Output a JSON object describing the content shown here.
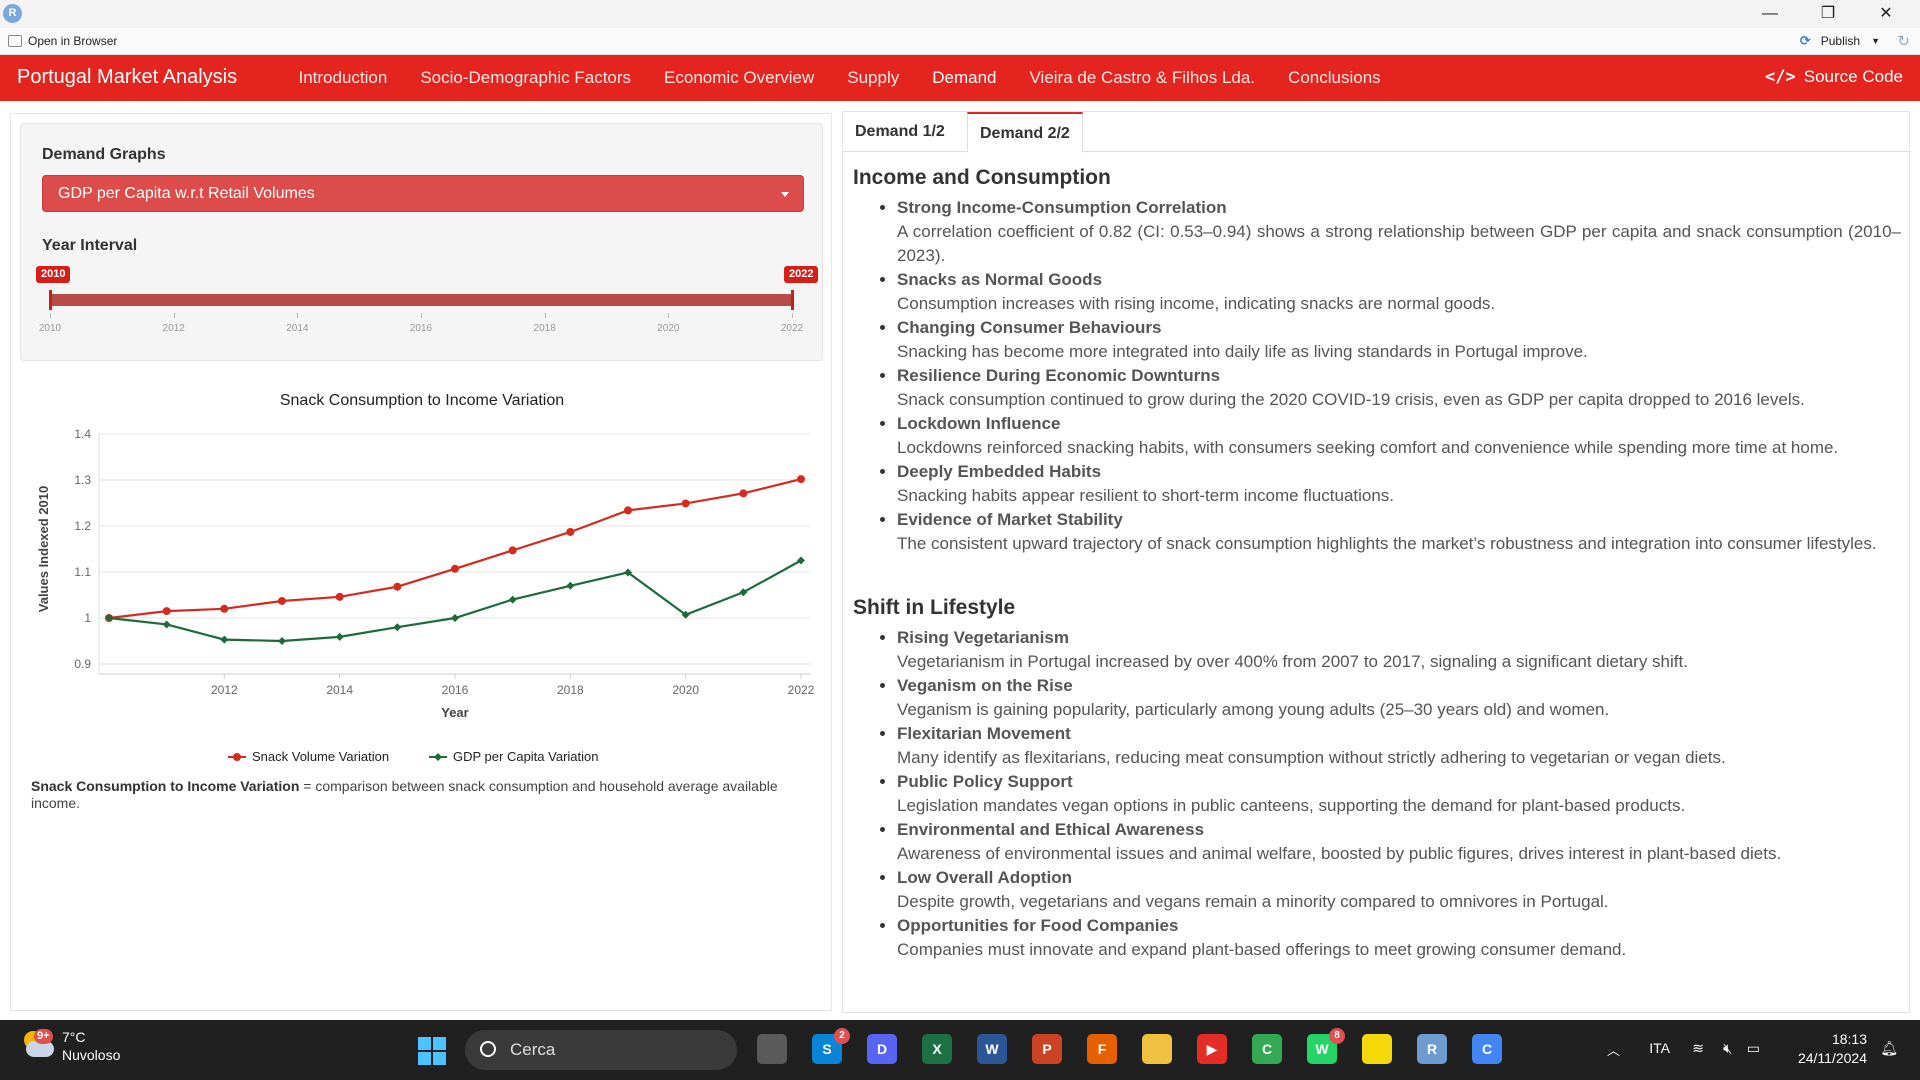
{
  "window": {
    "app_icon_letter": "R",
    "open_in_browser": "Open in Browser",
    "publish": "Publish",
    "minimize": "—",
    "restore": "❐",
    "close": "✕"
  },
  "navbar": {
    "brand": "Portugal Market Analysis",
    "links": [
      "Introduction",
      "Socio-Demographic Factors",
      "Economic Overview",
      "Supply",
      "Demand",
      "Vieira de Castro & Filhos Lda.",
      "Conclusions"
    ],
    "active": "Demand",
    "source_code": "Source Code",
    "accent": "#e3241f"
  },
  "controls": {
    "graphs_label": "Demand Graphs",
    "graph_selected": "GDP per Capita w.r.t Retail Volumes",
    "year_label": "Year Interval",
    "year_from": "2010",
    "year_to": "2022",
    "year_ticks": [
      "2010",
      "2012",
      "2014",
      "2016",
      "2018",
      "2020",
      "2022"
    ]
  },
  "chart_data": {
    "type": "line",
    "title": "Snack Consumption to Income Variation",
    "xlabel": "Year",
    "ylabel": "Values Indexed 2010",
    "x": [
      2010,
      2011,
      2012,
      2013,
      2014,
      2015,
      2016,
      2017,
      2018,
      2019,
      2020,
      2021,
      2022
    ],
    "ylim": [
      0.9,
      1.4
    ],
    "yticks": [
      "0.9",
      "1",
      "1.1",
      "1.2",
      "1.3",
      "1.4"
    ],
    "xticks": [
      "2012",
      "2014",
      "2016",
      "2018",
      "2020",
      "2022"
    ],
    "series": [
      {
        "name": "Snack Volume Variation",
        "color": "#d42a1f",
        "values": [
          1.0,
          1.015,
          1.02,
          1.037,
          1.046,
          1.068,
          1.107,
          1.147,
          1.187,
          1.234,
          1.249,
          1.271,
          1.302
        ]
      },
      {
        "name": "GDP per Capita Variation",
        "color": "#1e6b3a",
        "values": [
          1.0,
          0.986,
          0.953,
          0.95,
          0.959,
          0.98,
          1.0,
          1.04,
          1.07,
          1.099,
          1.007,
          1.056,
          1.125
        ]
      }
    ],
    "legend": "bottom",
    "grid": true
  },
  "caption": {
    "bold": "Snack Consumption to Income Variation",
    "text": " = comparison between snack consumption and household average available income."
  },
  "tabs": [
    "Demand 1/2",
    "Demand 2/2"
  ],
  "active_tab": "Demand 2/2",
  "sections": [
    {
      "title": "Income and Consumption",
      "items": [
        {
          "head": "Strong Income-Consumption Correlation",
          "body": "A correlation coefficient of 0.82 (CI: 0.53–0.94) shows a strong relationship between GDP per capita and snack consumption (2010–2023)."
        },
        {
          "head": "Snacks as Normal Goods",
          "body": "Consumption increases with rising income, indicating snacks are normal goods."
        },
        {
          "head": "Changing Consumer Behaviours",
          "body": "Snacking has become more integrated into daily life as living standards in Portugal improve."
        },
        {
          "head": "Resilience During Economic Downturns",
          "body": "Snack consumption continued to grow during the 2020 COVID-19 crisis, even as GDP per capita dropped to 2016 levels."
        },
        {
          "head": "Lockdown Influence",
          "body": "Lockdowns reinforced snacking habits, with consumers seeking comfort and convenience while spending more time at home."
        },
        {
          "head": "Deeply Embedded Habits",
          "body": "Snacking habits appear resilient to short-term income fluctuations."
        },
        {
          "head": "Evidence of Market Stability",
          "body": "The consistent upward trajectory of snack consumption highlights the market’s robustness and integration into consumer lifestyles."
        }
      ]
    },
    {
      "title": "Shift in Lifestyle",
      "items": [
        {
          "head": "Rising Vegetarianism",
          "body": "Vegetarianism in Portugal increased by over 400% from 2007 to 2017, signaling a significant dietary shift."
        },
        {
          "head": "Veganism on the Rise",
          "body": "Veganism is gaining popularity, particularly among young adults (25–30 years old) and women."
        },
        {
          "head": "Flexitarian Movement",
          "body": "Many identify as flexitarians, reducing meat consumption without strictly adhering to vegetarian or vegan diets."
        },
        {
          "head": "Public Policy Support",
          "body": "Legislation mandates vegan options in public canteens, supporting the demand for plant-based products."
        },
        {
          "head": "Environmental and Ethical Awareness",
          "body": "Awareness of environmental issues and animal welfare, boosted by public figures, drives interest in plant-based diets."
        },
        {
          "head": "Low Overall Adoption",
          "body": "Despite growth, vegetarians and vegans remain a minority compared to omnivores in Portugal."
        },
        {
          "head": "Opportunities for Food Companies",
          "body": "Companies must innovate and expand plant-based offerings to meet growing consumer demand."
        }
      ]
    }
  ],
  "taskbar": {
    "weather_badge": "9+",
    "temp": "7°C",
    "condition": "Nuvoloso",
    "search": "Cerca",
    "apps": [
      {
        "name": "task-view",
        "label": "",
        "color": "#5a5a5a",
        "badge": ""
      },
      {
        "name": "skype",
        "label": "S",
        "color": "#0a84d6",
        "badge": "2"
      },
      {
        "name": "discord",
        "label": "D",
        "color": "#5865f2",
        "badge": ""
      },
      {
        "name": "excel",
        "label": "X",
        "color": "#1d7044",
        "badge": ""
      },
      {
        "name": "word",
        "label": "W",
        "color": "#2b5797",
        "badge": ""
      },
      {
        "name": "powerpoint",
        "label": "P",
        "color": "#c94324",
        "badge": ""
      },
      {
        "name": "firefox",
        "label": "F",
        "color": "#e66000",
        "badge": ""
      },
      {
        "name": "file-explorer",
        "label": "",
        "color": "#f0c040",
        "badge": ""
      },
      {
        "name": "youtube",
        "label": "▶",
        "color": "#e52d27",
        "badge": ""
      },
      {
        "name": "chrome",
        "label": "C",
        "color": "#34a853",
        "badge": ""
      },
      {
        "name": "whatsapp",
        "label": "W",
        "color": "#25d366",
        "badge": "8"
      },
      {
        "name": "sticky-notes",
        "label": "",
        "color": "#f5d90a",
        "badge": ""
      },
      {
        "name": "rstudio",
        "label": "R",
        "color": "#6f9bd1",
        "badge": ""
      },
      {
        "name": "chrome-profile",
        "label": "C",
        "color": "#4285f4",
        "badge": ""
      }
    ],
    "lang": "ITA",
    "time": "18:13",
    "date": "24/11/2024"
  }
}
